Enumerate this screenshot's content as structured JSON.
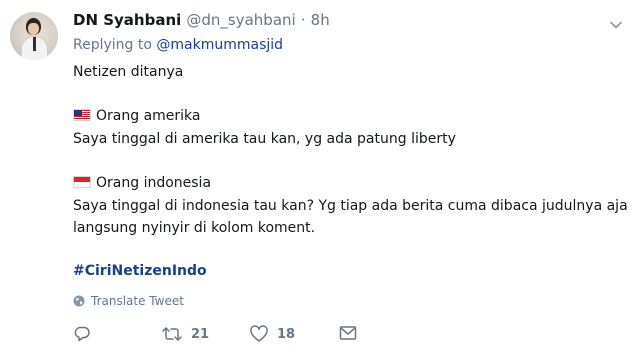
{
  "tweet": {
    "display_name": "DN Syahbani",
    "handle": "@dn_syahbani",
    "separator": "·",
    "time": "8h",
    "replying_prefix": "Replying to",
    "replying_to": "@makmummasjid",
    "lines": {
      "intro": "Netizen ditanya",
      "us_label": "Orang amerika",
      "us_text": "Saya tinggal di amerika tau kan, yg ada patung liberty",
      "id_label": "Orang indonesia",
      "id_text_1": "Saya tinggal di indonesia tau kan? Yg tiap ada berita cuma dibaca judulnya aja &",
      "id_text_2": "langsung nyinyir di kolom koment."
    },
    "hashtag": "#CiriNetizenIndo",
    "translate_label": "Translate Tweet",
    "actions": {
      "reply_count": "",
      "retweet_count": "21",
      "like_count": "18"
    }
  },
  "colors": {
    "link": "#1b3f8f",
    "muted": "#657786",
    "text": "#14171a"
  },
  "icons": [
    "avatar",
    "chevron-down-icon",
    "us-flag-icon",
    "indonesia-flag-icon",
    "globe-icon",
    "reply-icon",
    "retweet-icon",
    "like-icon",
    "message-icon"
  ]
}
